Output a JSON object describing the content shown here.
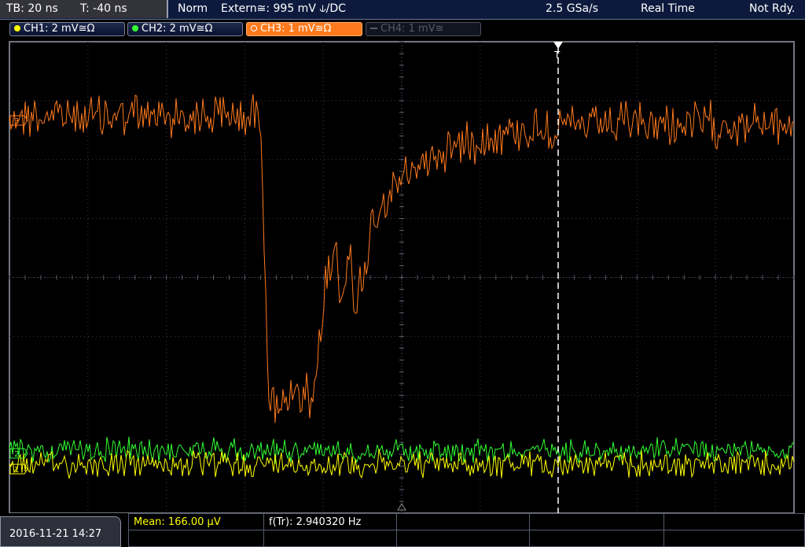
{
  "topbar": {
    "timebase": "TB: 20 ns",
    "trigger_offset": "T: -40 ns",
    "mode": "Norm",
    "trigger_source": "Extern≅: 995 mV ⫝/DC",
    "sample_rate": "2.5 GSa/s",
    "acq_mode": "Real Time",
    "status": "Not Rdy."
  },
  "channels": [
    {
      "label": "CH1: 2 mV≅Ω",
      "color": "#ffff00",
      "state": "on"
    },
    {
      "label": "CH2: 2 mV≅Ω",
      "color": "#33ff33",
      "state": "on"
    },
    {
      "label": "CH3: 1 mV≅Ω",
      "color": "#ff7a1c",
      "state": "active"
    },
    {
      "label": "CH4: 1 mV≅",
      "color": "#555a66",
      "state": "off"
    }
  ],
  "markers": {
    "ch3": "3",
    "ch1": "1",
    "ch2": "2",
    "trigger": "T"
  },
  "bottom": {
    "datetime": "2016-11-21 14:27",
    "measurements": [
      {
        "label": "Mean: 166.00 μV",
        "highlight": true
      },
      {
        "label": "f(Tr): 2.940320 Hz",
        "highlight": false
      }
    ]
  },
  "colors": {
    "ch1": "#ffff00",
    "ch2": "#33ff33",
    "ch3": "#ff7a1c",
    "grid": "#3c4150",
    "background": "#000000"
  }
}
